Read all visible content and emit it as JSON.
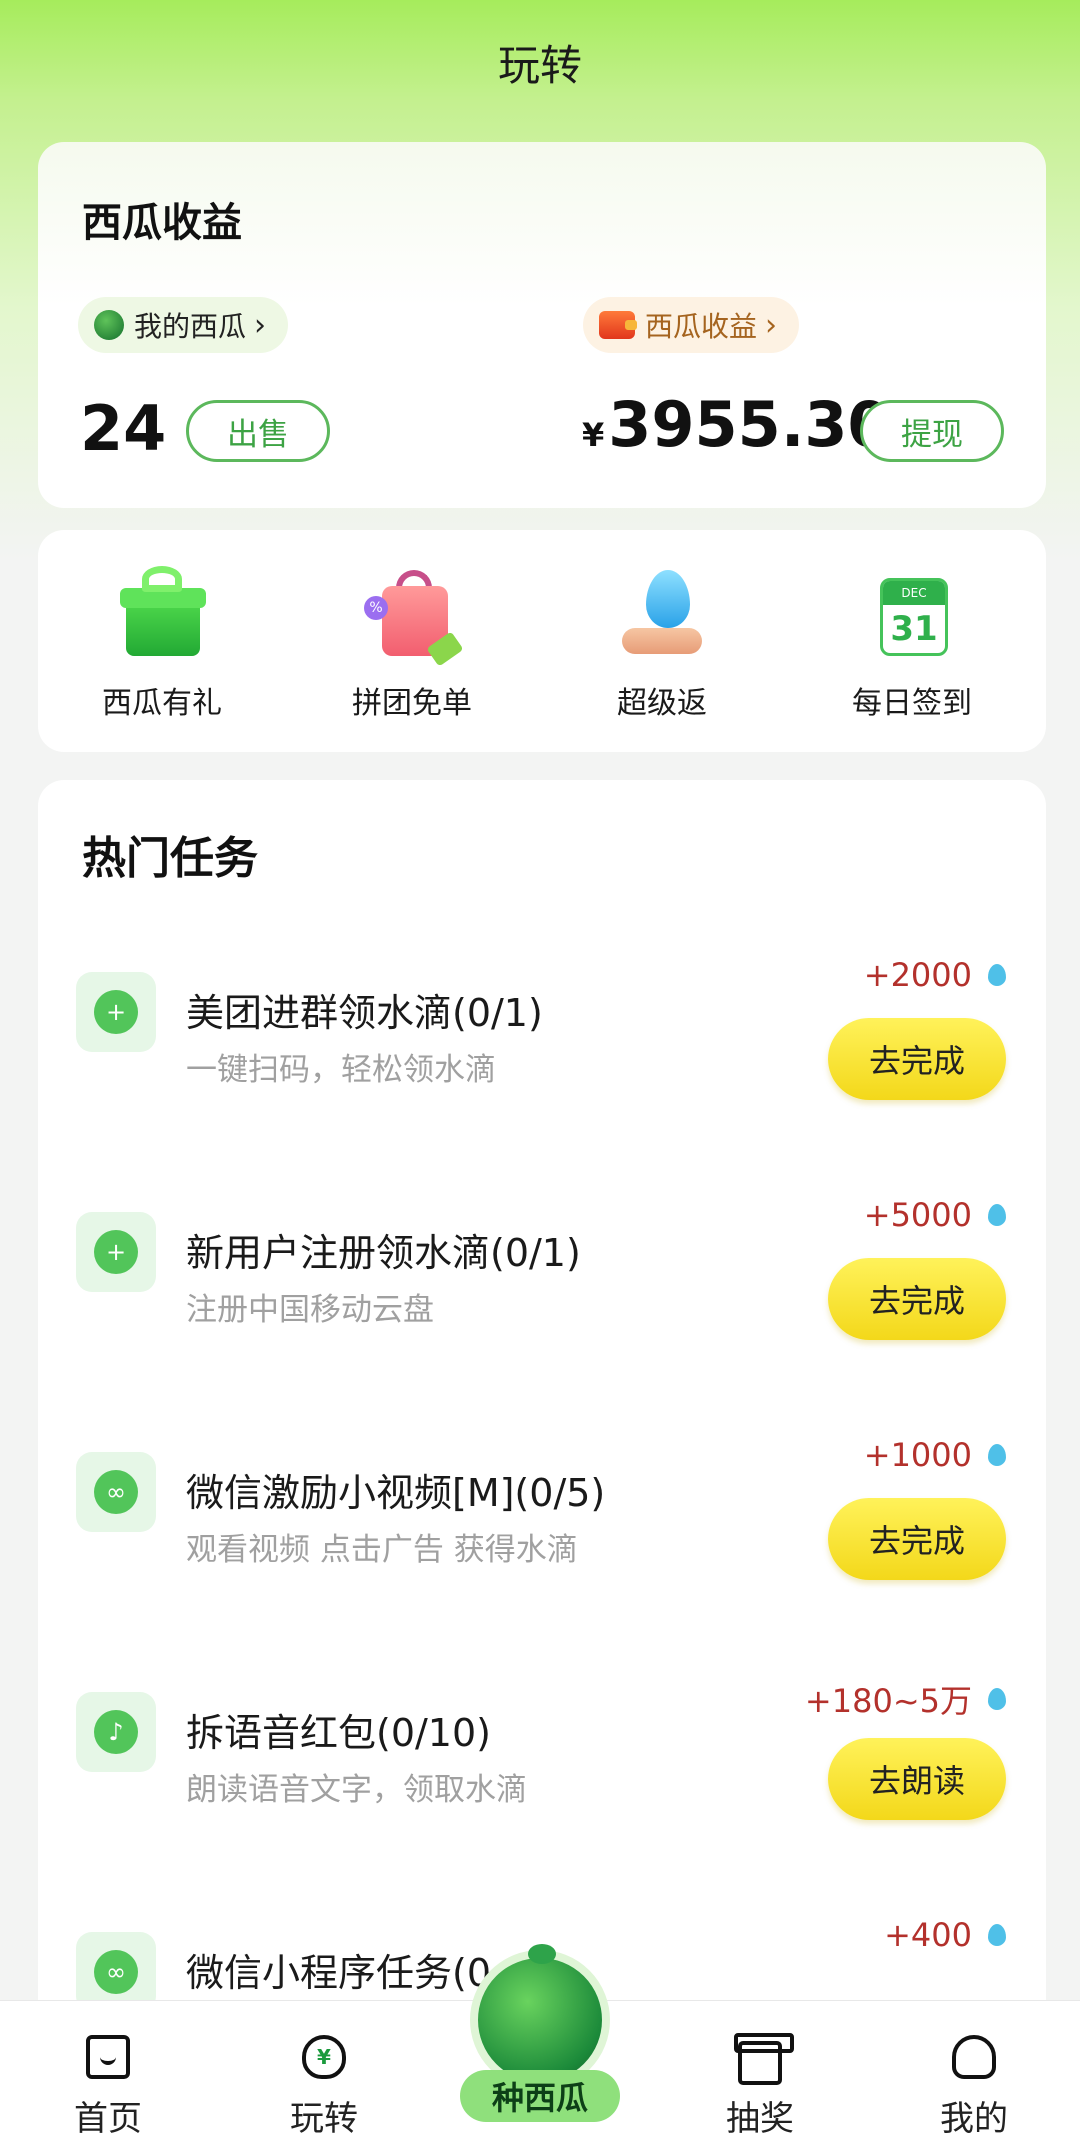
{
  "header": {
    "title": "玩转"
  },
  "earnings": {
    "title": "西瓜收益",
    "my_melon_label": "我的西瓜",
    "melon_count": "24",
    "sell_label": "出售",
    "income_label": "西瓜收益",
    "currency": "¥",
    "income_amount": "3955.30",
    "withdraw_label": "提现"
  },
  "quick_actions": [
    {
      "label": "西瓜有礼",
      "icon": "gift-box-icon"
    },
    {
      "label": "拼团免单",
      "icon": "shopping-bag-icon"
    },
    {
      "label": "超级返",
      "icon": "water-drop-hand-icon"
    },
    {
      "label": "每日签到",
      "icon": "calendar-icon",
      "icon_text": "31",
      "icon_month": "DEC"
    }
  ],
  "tasks": {
    "title": "热门任务",
    "items": [
      {
        "name": "美团进群领水滴(0/1)",
        "desc": "一键扫码，轻松领水滴",
        "reward": "+2000",
        "button": "去完成",
        "icon": "add-user-icon"
      },
      {
        "name": "新用户注册领水滴(0/1)",
        "desc": "注册中国移动云盘",
        "reward": "+5000",
        "button": "去完成",
        "icon": "add-user-icon"
      },
      {
        "name": "微信激励小视频[M](0/5)",
        "desc": "观看视频 点击广告 获得水滴",
        "reward": "+1000",
        "button": "去完成",
        "icon": "mini-program-icon"
      },
      {
        "name": "拆语音红包(0/10)",
        "desc": "朗读语音文字，领取水滴",
        "reward": "+180~5万",
        "button": "去朗读",
        "icon": "voice-envelope-icon"
      },
      {
        "name": "微信小程序任务(0",
        "desc": "",
        "reward": "+400",
        "button": "",
        "icon": "mini-program-icon"
      }
    ]
  },
  "tabbar": {
    "home": "首页",
    "play": "玩转",
    "plant": "种西瓜",
    "lottery": "抽奖",
    "mine": "我的"
  },
  "colors": {
    "accent_green": "#5cb85c",
    "reward_red": "#b3312c",
    "button_yellow": "#f3d81a"
  }
}
